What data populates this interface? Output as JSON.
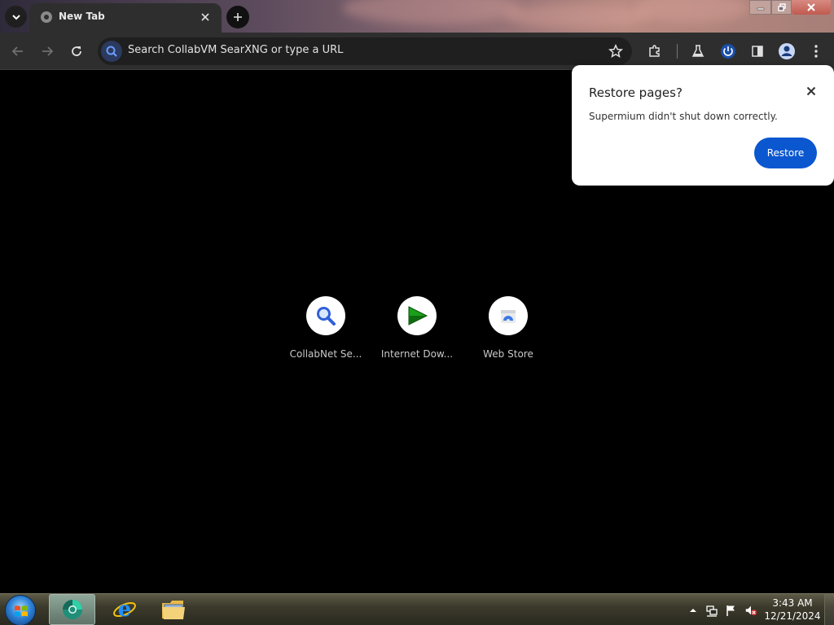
{
  "browser": {
    "tab": {
      "title": "New Tab"
    },
    "omnibox": {
      "placeholder": "Search CollabVM SearXNG or type a URL"
    }
  },
  "shortcuts": [
    {
      "label": "CollabNet Se...",
      "icon": "search-icon"
    },
    {
      "label": "Internet Dow...",
      "icon": "play-icon"
    },
    {
      "label": "Web Store",
      "icon": "web-store-icon"
    }
  ],
  "restore_bubble": {
    "title": "Restore pages?",
    "message": "Supermium didn't shut down correctly.",
    "button_label": "Restore"
  },
  "taskbar": {
    "clock_time": "3:43 AM",
    "clock_date": "12/21/2024"
  },
  "colors": {
    "accent_button": "#0b57d0",
    "toolbar": "#2e2e2e",
    "content_background": "#000000"
  }
}
